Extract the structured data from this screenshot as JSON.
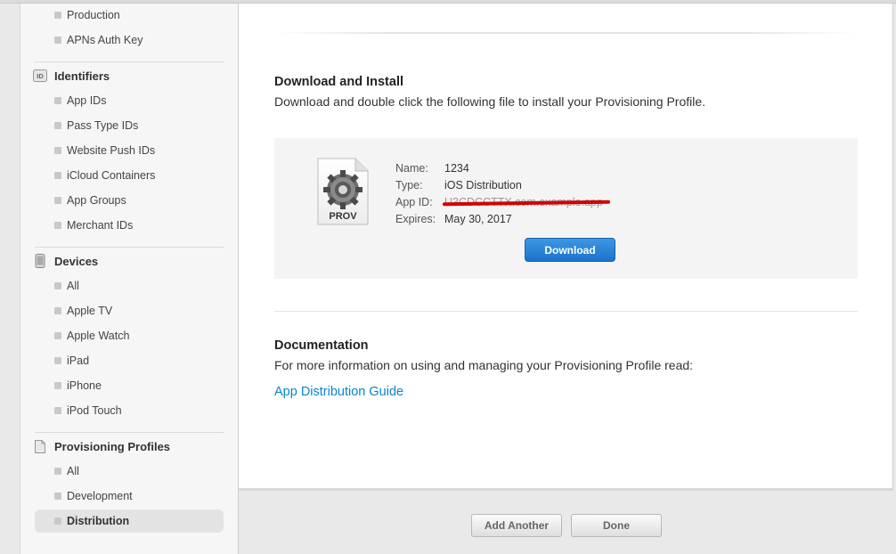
{
  "sidebar": {
    "top_items": [
      {
        "label": "Production"
      },
      {
        "label": "APNs Auth Key"
      }
    ],
    "identifiers": {
      "title": "Identifiers",
      "icon_text": "ID",
      "items": [
        {
          "label": "App IDs"
        },
        {
          "label": "Pass Type IDs"
        },
        {
          "label": "Website Push IDs"
        },
        {
          "label": "iCloud Containers"
        },
        {
          "label": "App Groups"
        },
        {
          "label": "Merchant IDs"
        }
      ]
    },
    "devices": {
      "title": "Devices",
      "items": [
        {
          "label": "All"
        },
        {
          "label": "Apple TV"
        },
        {
          "label": "Apple Watch"
        },
        {
          "label": "iPad"
        },
        {
          "label": "iPhone"
        },
        {
          "label": "iPod Touch"
        }
      ]
    },
    "provisioning": {
      "title": "Provisioning Profiles",
      "items": [
        {
          "label": "All"
        },
        {
          "label": "Development"
        },
        {
          "label": "Distribution"
        }
      ],
      "active": "Distribution"
    }
  },
  "main": {
    "download": {
      "title": "Download and Install",
      "description": "Download and double click the following file to install your Provisioning Profile.",
      "icon_label": "PROV",
      "details": {
        "name_key": "Name:",
        "name_value": "1234",
        "type_key": "Type:",
        "type_value": "iOS Distribution",
        "appid_key": "App ID:",
        "appid_value": "U3CDCCTTX.com.example.app",
        "expires_key": "Expires:",
        "expires_value": "May 30, 2017"
      },
      "button_label": "Download"
    },
    "documentation": {
      "title": "Documentation",
      "description": "For more information on using and managing your Provisioning Profile read:",
      "link_label": "App Distribution Guide"
    }
  },
  "footer": {
    "add_another_label": "Add Another",
    "done_label": "Done"
  },
  "colors": {
    "accent": "#1a73cc",
    "link": "#0a84c8",
    "redaction": "#d40000"
  }
}
